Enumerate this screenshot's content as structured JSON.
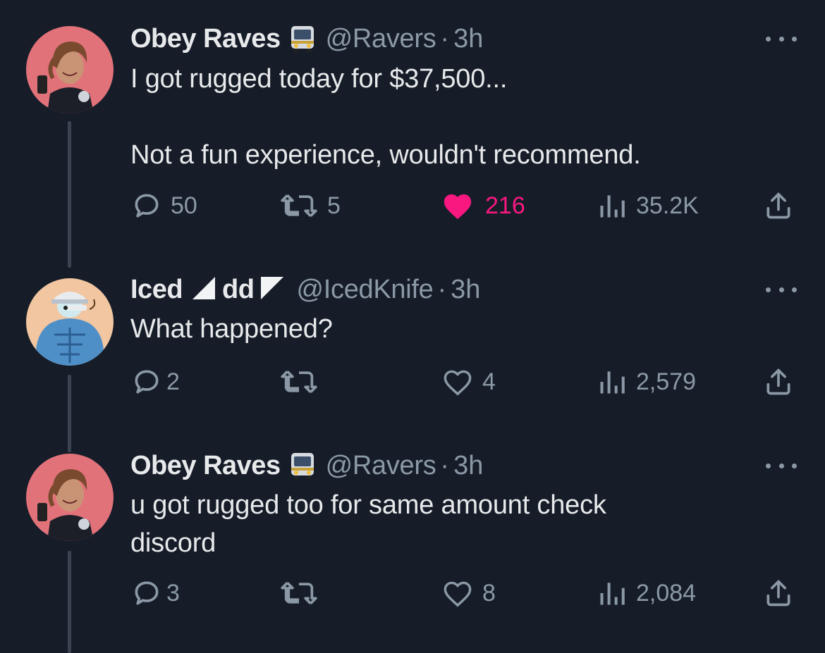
{
  "tweets": [
    {
      "name": "Obey Raves",
      "badge_icon": "bus-emoji",
      "handle": "@Ravers",
      "separator": "·",
      "time": "3h",
      "text": "I got rugged today for $37,500...\n\nNot a fun experience, wouldn't recommend.",
      "replies": "50",
      "retweets": "5",
      "likes": "216",
      "liked": true,
      "views": "35.2K"
    },
    {
      "name_part1": "Iced",
      "name_part2": "dd",
      "handle": "@IcedKnife",
      "separator": "·",
      "time": "3h",
      "text": "What happened?",
      "replies": "2",
      "retweets": "",
      "likes": "4",
      "liked": false,
      "views": "2,579"
    },
    {
      "name": "Obey Raves",
      "badge_icon": "bus-emoji",
      "handle": "@Ravers",
      "separator": "·",
      "time": "3h",
      "text": "u got rugged too for same amount check\ndiscord",
      "replies": "3",
      "retweets": "",
      "likes": "8",
      "liked": false,
      "views": "2,084"
    }
  ],
  "colors": {
    "background": "#161d29",
    "text": "#e7e9ea",
    "muted": "#8b98a5",
    "like_pink": "#f91880",
    "thread_line": "#3a4450"
  }
}
